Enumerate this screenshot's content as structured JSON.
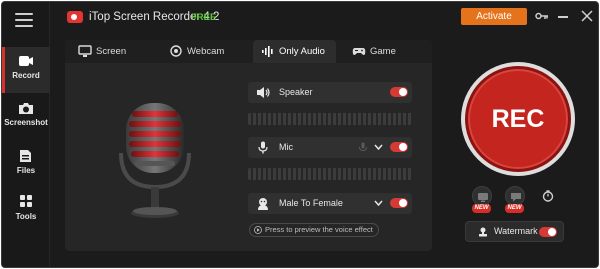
{
  "window": {
    "title": "iTop Screen Recorder 4.2",
    "badge": "FREE"
  },
  "titlebar": {
    "activate_label": "Activate"
  },
  "sidebar": {
    "items": [
      {
        "label": "Record",
        "icon": "record-icon",
        "active": true
      },
      {
        "label": "Screenshot",
        "icon": "camera-icon",
        "active": false
      },
      {
        "label": "Files",
        "icon": "files-icon",
        "active": false
      },
      {
        "label": "Tools",
        "icon": "tools-icon",
        "active": false
      }
    ]
  },
  "tabs": [
    {
      "label": "Screen",
      "icon": "monitor-icon",
      "active": false
    },
    {
      "label": "Webcam",
      "icon": "webcam-icon",
      "active": false
    },
    {
      "label": "Only Audio",
      "icon": "audio-wave-icon",
      "active": true
    },
    {
      "label": "Game",
      "icon": "gamepad-icon",
      "active": false
    }
  ],
  "audio": {
    "speaker": {
      "label": "Speaker",
      "enabled": true
    },
    "mic": {
      "label": "Mic",
      "enabled": true
    },
    "voice_changer": {
      "label": "Male To Female",
      "enabled": true
    },
    "preview_label": "Press to preview the voice effect"
  },
  "record": {
    "rec_label": "REC"
  },
  "badges": {
    "new_label": "NEW"
  },
  "watermark": {
    "label": "Watermark",
    "enabled": true
  },
  "colors": {
    "accent": "#d63a34",
    "rec": "#c4251f",
    "activate": "#e5731c",
    "free": "#5cc73a"
  }
}
